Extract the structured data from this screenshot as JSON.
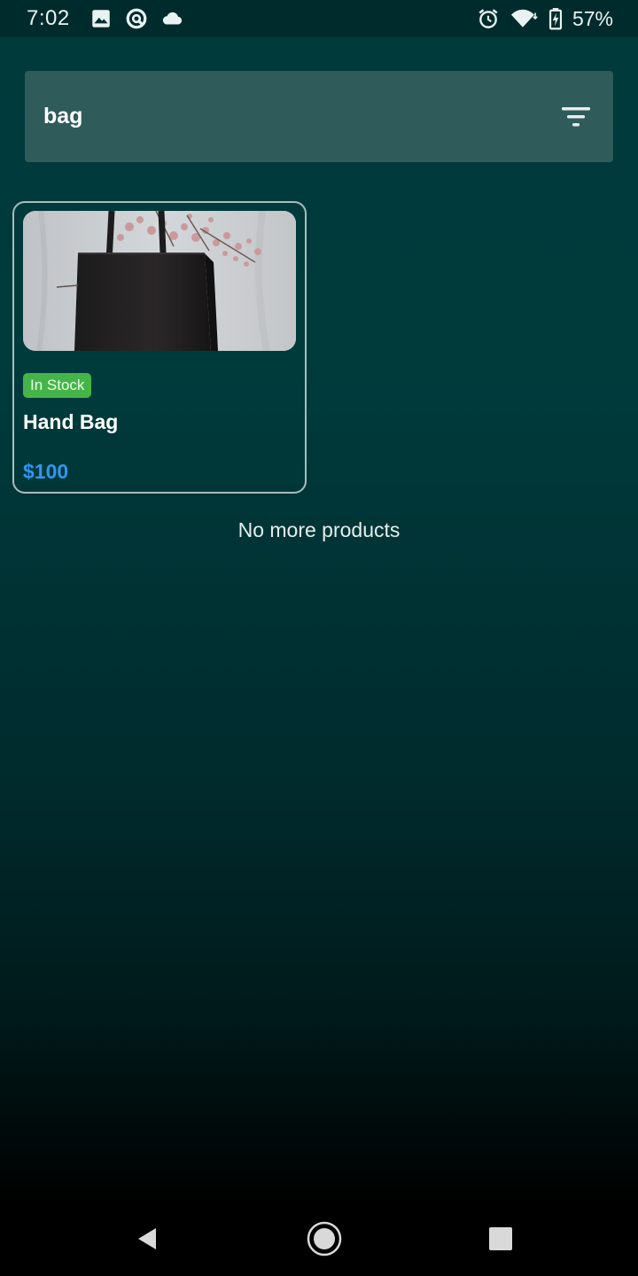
{
  "status_bar": {
    "time": "7:02",
    "battery_percent": "57%",
    "left_icons": [
      "image-icon",
      "data-saver-icon",
      "cloud-icon"
    ],
    "right_icons": [
      "alarm-icon",
      "wifi-icon",
      "battery-charging-icon"
    ]
  },
  "search": {
    "query": "bag",
    "filter_icon": "filter-icon"
  },
  "products": [
    {
      "badge": "In Stock",
      "name": "Hand Bag",
      "price": "$100"
    }
  ],
  "footer_message": "No more products",
  "nav_bar": {
    "icons": [
      "back-icon",
      "home-icon",
      "recents-icon"
    ]
  },
  "colors": {
    "background_top": "#003a3b",
    "search_bar": "#2f5b5b",
    "badge": "#46b549",
    "price": "#2f97f0",
    "card_border": "#a9bcbc"
  }
}
